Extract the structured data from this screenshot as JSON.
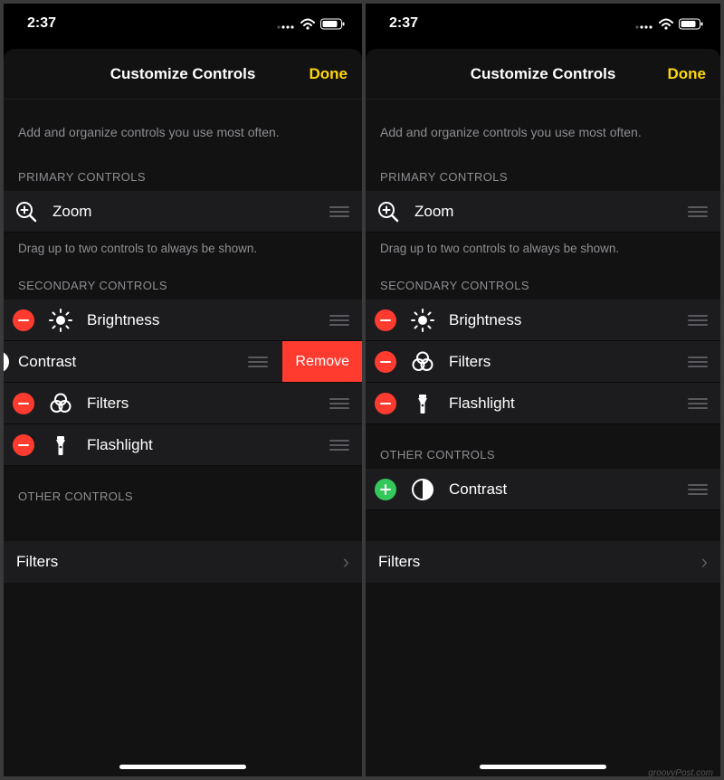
{
  "watermark": "groovyPost.com",
  "left": {
    "statusbar": {
      "time": "2:37"
    },
    "nav": {
      "title": "Customize Controls",
      "done": "Done"
    },
    "description": "Add and organize controls you use most often.",
    "primary_header": "PRIMARY CONTROLS",
    "primary": [
      {
        "label": "Zoom",
        "icon": "zoom"
      }
    ],
    "primary_footer": "Drag up to two controls to always be shown.",
    "secondary_header": "SECONDARY CONTROLS",
    "secondary": [
      {
        "label": "Brightness",
        "icon": "brightness",
        "action": "remove"
      },
      {
        "label": "Contrast",
        "icon": "contrast",
        "swiped_remove_label": "Remove"
      },
      {
        "label": "Filters",
        "icon": "filters",
        "action": "remove"
      },
      {
        "label": "Flashlight",
        "icon": "flashlight",
        "action": "remove"
      }
    ],
    "other_header": "OTHER CONTROLS",
    "other": [],
    "filters_row": "Filters"
  },
  "right": {
    "statusbar": {
      "time": "2:37"
    },
    "nav": {
      "title": "Customize Controls",
      "done": "Done"
    },
    "description": "Add and organize controls you use most often.",
    "primary_header": "PRIMARY CONTROLS",
    "primary": [
      {
        "label": "Zoom",
        "icon": "zoom"
      }
    ],
    "primary_footer": "Drag up to two controls to always be shown.",
    "secondary_header": "SECONDARY CONTROLS",
    "secondary": [
      {
        "label": "Brightness",
        "icon": "brightness",
        "action": "remove"
      },
      {
        "label": "Filters",
        "icon": "filters",
        "action": "remove"
      },
      {
        "label": "Flashlight",
        "icon": "flashlight",
        "action": "remove"
      }
    ],
    "other_header": "OTHER CONTROLS",
    "other": [
      {
        "label": "Contrast",
        "icon": "contrast",
        "action": "add"
      }
    ],
    "filters_row": "Filters"
  }
}
